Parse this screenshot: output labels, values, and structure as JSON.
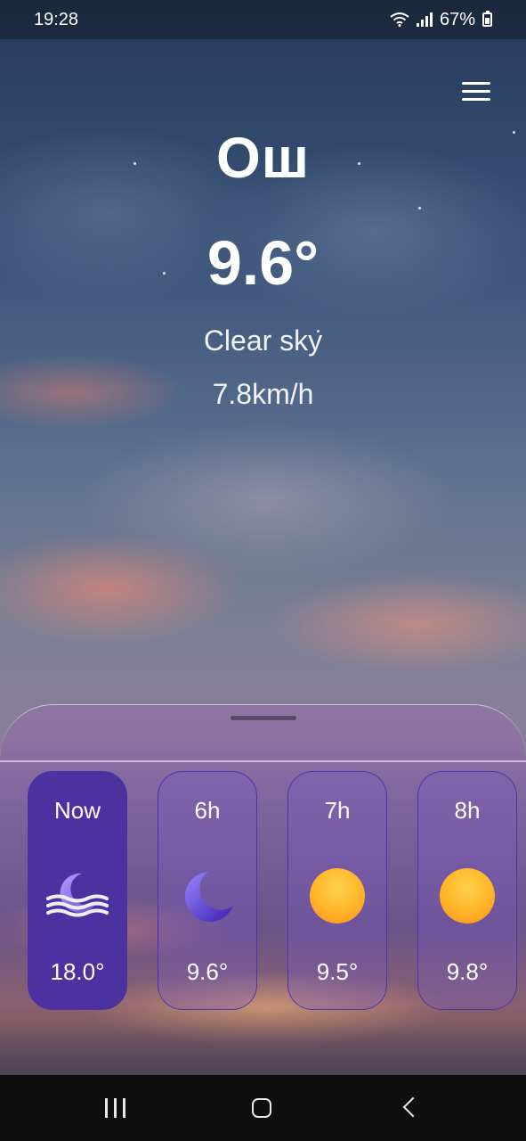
{
  "status_bar": {
    "time": "19:28",
    "battery_percent": "67%"
  },
  "city": "Ош",
  "current": {
    "temperature": "9.6°",
    "condition": "Clear sky",
    "wind": "7.8km/h"
  },
  "hourly": [
    {
      "label": "Now",
      "temp": "18.0°",
      "icon": "moon-windy-icon",
      "active": true
    },
    {
      "label": "6h",
      "temp": "9.6°",
      "icon": "moon-icon",
      "active": false
    },
    {
      "label": "7h",
      "temp": "9.5°",
      "icon": "sun-icon",
      "active": false
    },
    {
      "label": "8h",
      "temp": "9.8°",
      "icon": "sun-icon",
      "active": false
    }
  ],
  "colors": {
    "active_card": "#4c32a0",
    "card_border": "#4632aa",
    "sun": "#ffb529",
    "moon": "#6a4cd8"
  }
}
